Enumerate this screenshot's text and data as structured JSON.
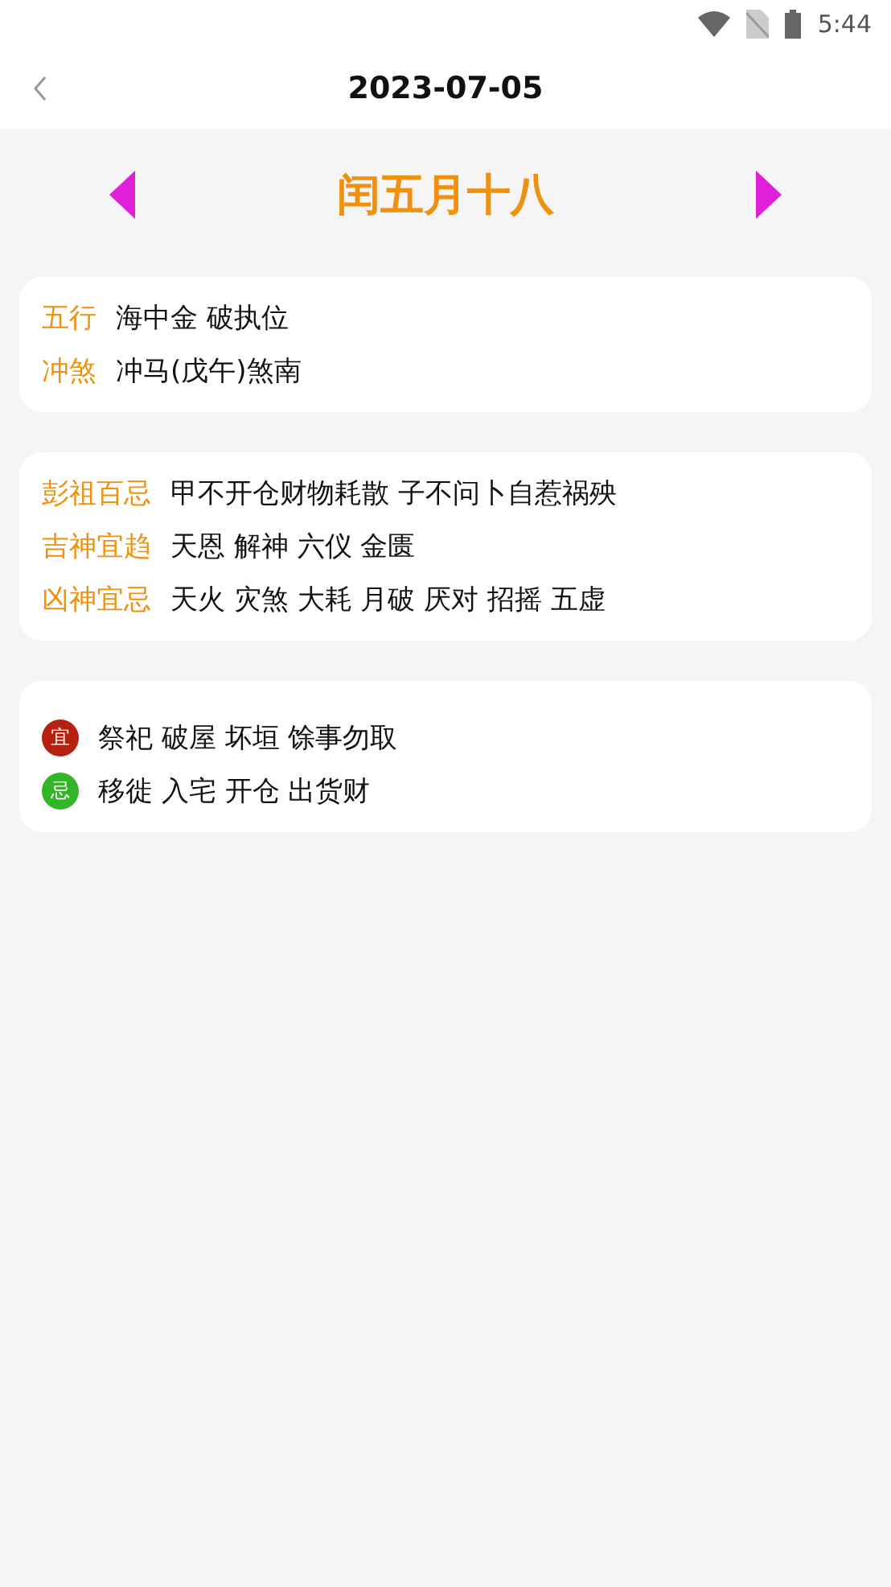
{
  "status_bar": {
    "time": "5:44"
  },
  "header": {
    "title": "2023-07-05"
  },
  "lunar": {
    "date": "闰五月十八"
  },
  "cards": [
    {
      "rows": [
        {
          "label": "五行",
          "value": "海中金 破执位"
        },
        {
          "label": "冲煞",
          "value": "冲马(戊午)煞南"
        }
      ]
    },
    {
      "rows": [
        {
          "label": "彭祖百忌",
          "value": "甲不开仓财物耗散 子不问卜自惹祸殃"
        },
        {
          "label": "吉神宜趋",
          "value": "天恩 解神 六仪 金匮"
        },
        {
          "label": "凶神宜忌",
          "value": "天火 灾煞 大耗 月破 厌对 招摇 五虚"
        }
      ]
    }
  ],
  "advice": [
    {
      "badge": "宜",
      "color": "#b5200f",
      "value": "祭祀 破屋 坏垣 馀事勿取"
    },
    {
      "badge": "忌",
      "color": "#33b52a",
      "value": "移徙 入宅 开仓 出货财"
    }
  ]
}
